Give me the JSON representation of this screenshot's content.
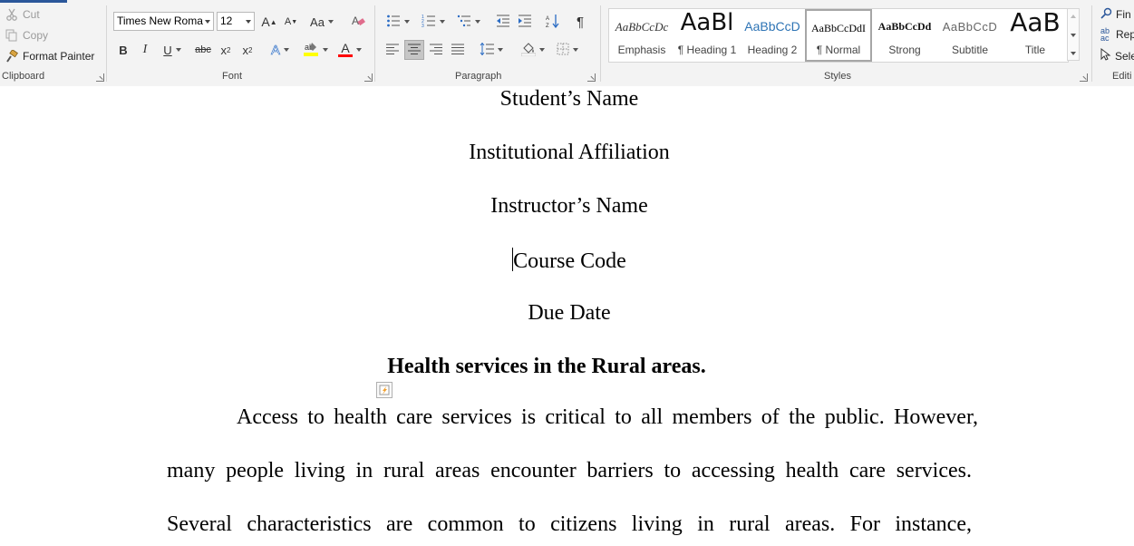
{
  "ribbon": {
    "clipboard": {
      "cut": "Cut",
      "copy": "Copy",
      "format_painter": "Format Painter",
      "label": "Clipboard"
    },
    "font": {
      "family": "Times New Roma",
      "size": "12",
      "grow": "A",
      "shrink": "A",
      "change_case": "Aa",
      "bold": "B",
      "italic": "I",
      "underline": "U",
      "strikethrough": "abc",
      "subscript": "x",
      "superscript": "x",
      "text_effects": "A",
      "font_color": "A",
      "highlight_color": "#ffff00",
      "font_color_value": "#ff0000",
      "label": "Font"
    },
    "paragraph": {
      "show_marks": "¶",
      "label": "Paragraph"
    },
    "styles": {
      "label": "Styles",
      "items": [
        {
          "sample": "AaBbCcDc",
          "name": "Emphasis"
        },
        {
          "sample": "AaBl",
          "name": "¶ Heading 1"
        },
        {
          "sample": "AaBbCcD",
          "name": "Heading 2"
        },
        {
          "sample": "AaBbCcDdI",
          "name": "¶ Normal"
        },
        {
          "sample": "AaBbCcDd",
          "name": "Strong"
        },
        {
          "sample": "AaBbCcD",
          "name": "Subtitle"
        },
        {
          "sample": "AaB",
          "name": "Title"
        }
      ],
      "selected": "¶ Normal"
    },
    "editing": {
      "find": "Fin",
      "replace": "Rep",
      "select": "Sele",
      "label": "Editi"
    }
  },
  "document": {
    "students_name": "Student’s Name",
    "institutional_affiliation": "Institutional Affiliation",
    "instructors_name": "Instructor’s Name",
    "course_code": "Course Code",
    "due_date": "Due Date",
    "title": "Health services in the Rural areas.",
    "paragraph_lines": [
      "Access to health care services is critical to all members of the public. However,",
      "many people living in rural areas encounter barriers to accessing health care services.",
      "Several characteristics are common to citizens living in rural areas. For instance,"
    ]
  },
  "colors": {
    "accent": "#2b579a",
    "heading_blue": "#2e74b5"
  }
}
